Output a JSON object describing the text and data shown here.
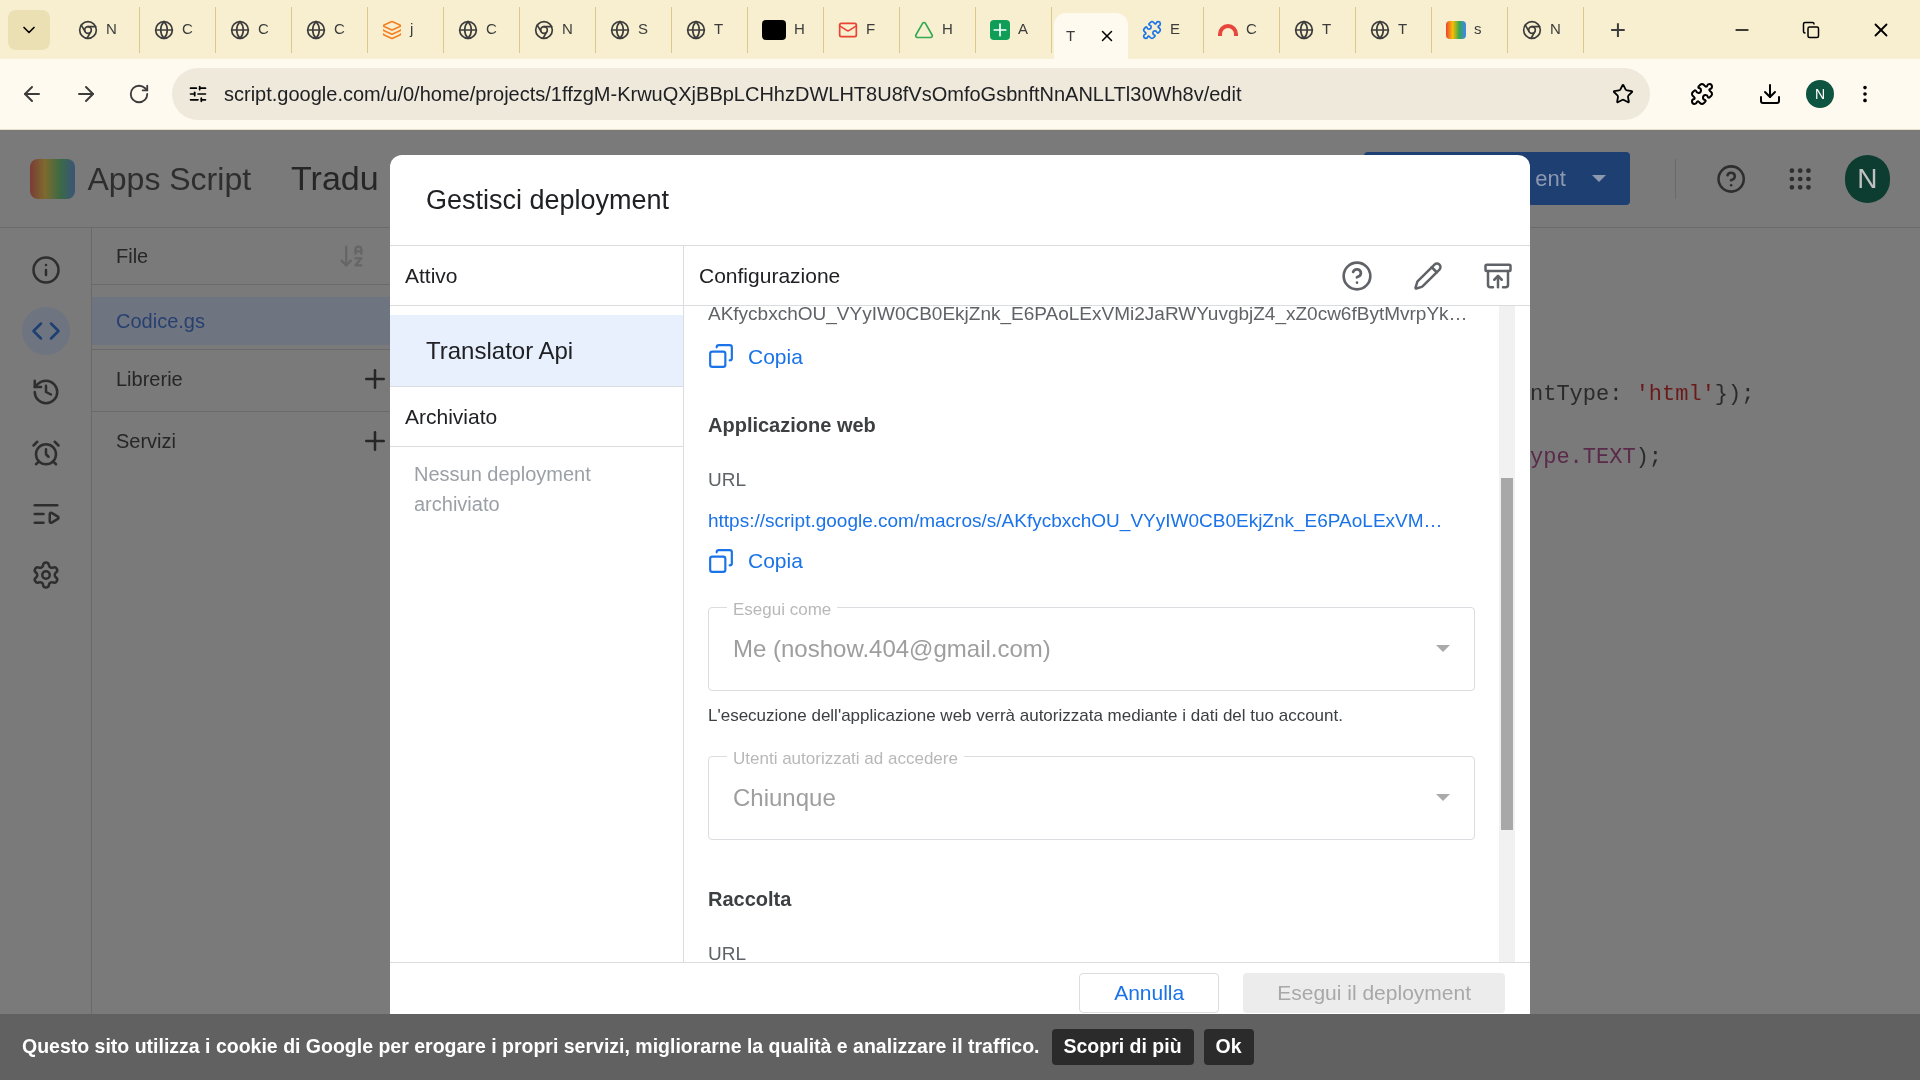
{
  "browser": {
    "tabs": [
      {
        "label": "N",
        "kind": "chrome",
        "selected": false
      },
      {
        "label": "C",
        "kind": "globe",
        "selected": false
      },
      {
        "label": "C",
        "kind": "globe",
        "selected": false
      },
      {
        "label": "C",
        "kind": "globe",
        "selected": false
      },
      {
        "label": "j",
        "kind": "stack",
        "selected": false
      },
      {
        "label": "C",
        "kind": "globe",
        "selected": false
      },
      {
        "label": "N",
        "kind": "chrome",
        "selected": false
      },
      {
        "label": "S",
        "kind": "globe",
        "selected": false
      },
      {
        "label": "T",
        "kind": "globe",
        "selected": false
      },
      {
        "label": "H",
        "kind": "dev",
        "selected": false
      },
      {
        "label": "F",
        "kind": "mail",
        "selected": false
      },
      {
        "label": "H",
        "kind": "drive",
        "selected": false
      },
      {
        "label": "A",
        "kind": "sheet",
        "selected": false
      },
      {
        "label": "T",
        "kind": "plain",
        "selected": true
      },
      {
        "label": "E",
        "kind": "puzzle",
        "selected": false
      },
      {
        "label": "C",
        "kind": "rainbow",
        "selected": false
      },
      {
        "label": "T",
        "kind": "globe",
        "selected": false
      },
      {
        "label": "T",
        "kind": "globe",
        "selected": false
      },
      {
        "label": "s",
        "kind": "script",
        "selected": false
      },
      {
        "label": "N",
        "kind": "chrome",
        "selected": false
      }
    ],
    "new_tab": "+",
    "address": "script.google.com/u/0/home/projects/1ffzgM-KrwuQXjBBpLCHhzDWLHT8U8fVsOmfoGsbnftNnANLLTl30Wh8v/edit",
    "profile": "N"
  },
  "app": {
    "name": "Apps Script",
    "project_title": "Tradu",
    "deploy_button": "ent",
    "avatar": "N",
    "rail": [
      {
        "kind": "info",
        "selected": false
      },
      {
        "kind": "code",
        "selected": true
      },
      {
        "kind": "history",
        "selected": false
      },
      {
        "kind": "triggers",
        "selected": false
      },
      {
        "kind": "executions",
        "selected": false
      },
      {
        "kind": "settings",
        "selected": false
      }
    ],
    "files_header": "File",
    "files": [
      {
        "name": "Codice.gs",
        "selected": true
      }
    ],
    "sections": [
      "Librerie",
      "Servizi"
    ],
    "code_lines": [
      [
        {
          "text": "ntType: ",
          "kind": "plain"
        },
        {
          "text": "'html'",
          "kind": "string"
        },
        {
          "text": "});",
          "kind": "plain"
        }
      ],
      [
        {
          "text": "ype.TEXT",
          "kind": "member"
        },
        {
          "text": ");",
          "kind": "plain"
        }
      ]
    ]
  },
  "dialog": {
    "title": "Gestisci deployment",
    "active_heading": "Attivo",
    "deployments": [
      {
        "label": "Translator Api",
        "selected": true
      }
    ],
    "archived_heading": "Archiviato",
    "archived_empty": "Nessun deployment archiviato",
    "config_heading": "Configurazione",
    "deployment_id": "AKfycbxchOU_VYyIW0CB0EkjZnk_E6PAoLExVMi2JaRWYuvgbjZ4_xZ0cw6fBytMvrpYk…",
    "copy_1": "Copia",
    "webapp_heading": "Applicazione web",
    "url_label": "URL",
    "url": "https://script.google.com/macros/s/AKfycbxchOU_VYyIW0CB0EkjZnk_E6PAoLExVM…",
    "copy_2": "Copia",
    "selects": [
      {
        "label": "Esegui come",
        "value": "Me (noshow.404@gmail.com)",
        "disabled": true,
        "note": "L'esecuzione dell'applicazione web verrà autorizzata mediante i dati del tuo account."
      },
      {
        "label": "Utenti autorizzati ad accedere",
        "value": "Chiunque",
        "disabled": true
      }
    ],
    "library_heading": "Raccolta",
    "library_url_label": "URL",
    "buttons": [
      {
        "label": "Annulla",
        "kind": "secondary",
        "disabled": false
      },
      {
        "label": "Esegui il deployment",
        "kind": "primary",
        "disabled": true
      }
    ]
  },
  "cookie_bar": {
    "message": "Questo sito utilizza i cookie di Google per erogare i propri servizi, migliorarne la qualità e analizzare il traffico.",
    "buttons": [
      "Scopri di più",
      "Ok"
    ]
  }
}
